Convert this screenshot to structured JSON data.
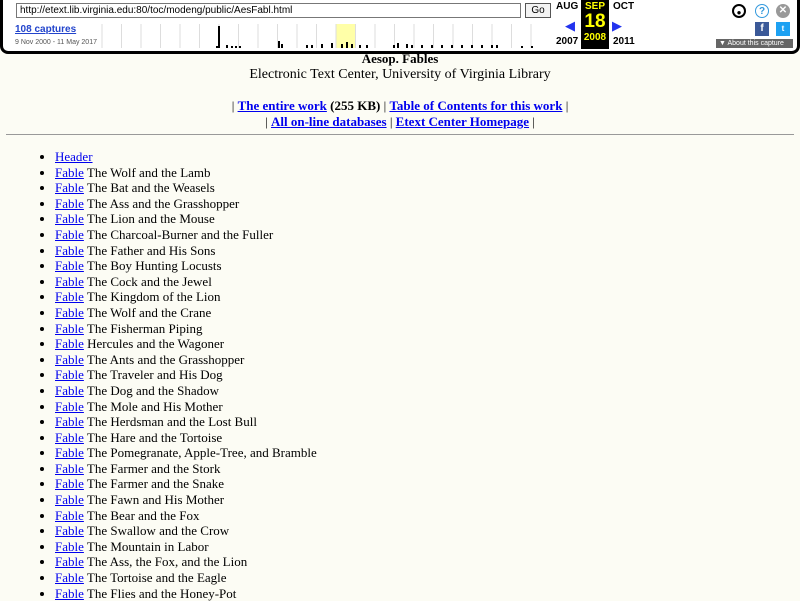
{
  "wayback": {
    "url": "http://etext.lib.virginia.edu:80/toc/modeng/public/AesFabl.html",
    "go": "Go",
    "captures": "108 captures",
    "range": "9 Nov 2000 - 11 May 2017",
    "prev_month": "AUG",
    "cur_month": "SEP",
    "next_month": "OCT",
    "day": "18",
    "prev_year": "2007",
    "cur_year": "2008",
    "next_year": "2011",
    "about": "About this capture"
  },
  "header": {
    "title": "Aesop. Fables",
    "subtitle": "Electronic Text Center, University of Virginia Library",
    "entire_work": "The entire work",
    "size": "(255 KB)",
    "toc": "Table of Contents for this work",
    "databases": "All on-line databases",
    "homepage": "Etext Center Homepage",
    "sep": "|"
  },
  "list": {
    "header": "Header",
    "link": "Fable",
    "items": [
      "The Wolf and the Lamb",
      "The Bat and the Weasels",
      "The Ass and the Grasshopper",
      "The Lion and the Mouse",
      "The Charcoal-Burner and the Fuller",
      "The Father and His Sons",
      "The Boy Hunting Locusts",
      "The Cock and the Jewel",
      "The Kingdom of the Lion",
      "The Wolf and the Crane",
      "The Fisherman Piping",
      "Hercules and the Wagoner",
      "The Ants and the Grasshopper",
      "The Traveler and His Dog",
      "The Dog and the Shadow",
      "The Mole and His Mother",
      "The Herdsman and the Lost Bull",
      "The Hare and the Tortoise",
      "The Pomegranate, Apple-Tree, and Bramble",
      "The Farmer and the Stork",
      "The Farmer and the Snake",
      "The Fawn and His Mother",
      "The Bear and the Fox",
      "The Swallow and the Crow",
      "The Mountain in Labor",
      "The Ass, the Fox, and the Lion",
      "The Tortoise and the Eagle",
      "The Flies and the Honey-Pot"
    ]
  }
}
